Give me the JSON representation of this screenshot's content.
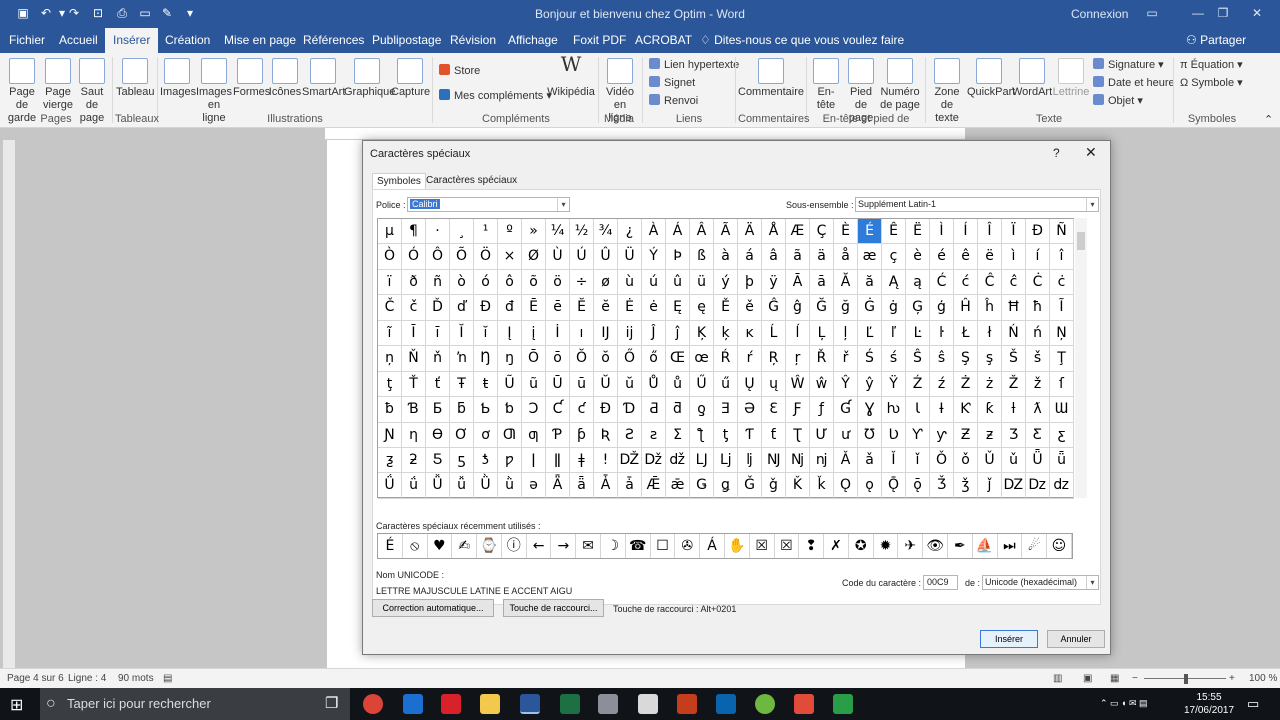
{
  "app": {
    "title": "Bonjour et bienvenu chez Optim - Word",
    "signin": "Connexion",
    "share": "Partager",
    "tell_me": "Dites-nous ce que vous voulez faire"
  },
  "tabs": [
    "Fichier",
    "Accueil",
    "Insérer",
    "Création",
    "Mise en page",
    "Références",
    "Publipostage",
    "Révision",
    "Affichage",
    "Foxit PDF",
    "ACROBAT"
  ],
  "ribbon": {
    "pages": [
      "Page de garde",
      "Page vierge",
      "Saut de page"
    ],
    "tableau": "Tableau",
    "illustrations": [
      "Images",
      "Images en ligne",
      "Formes",
      "Icônes",
      "SmartArt",
      "Graphique",
      "Capture"
    ],
    "store": "Store",
    "mes_complements": "Mes compléments",
    "wikipedia": "Wikipédia",
    "video": "Vidéo en ligne",
    "liens": [
      "Lien hypertexte",
      "Signet",
      "Renvoi"
    ],
    "commentaire": "Commentaire",
    "entete": [
      "En-tête",
      "Pied de page",
      "Numéro de page"
    ],
    "texte": [
      "Zone de texte",
      "QuickPart",
      "WordArt",
      "Lettrine"
    ],
    "texte_small": [
      "Signature",
      "Date et heure",
      "Objet"
    ],
    "symboles": [
      "Équation",
      "Symbole"
    ],
    "groups": [
      "Pages",
      "Tableaux",
      "Illustrations",
      "Compléments",
      "Média",
      "Liens",
      "Commentaires",
      "En-tête et pied de page",
      "Texte",
      "Symboles"
    ]
  },
  "dialog": {
    "title": "Caractères spéciaux",
    "help": "?",
    "tabs": [
      "Symboles",
      "Caractères spéciaux"
    ],
    "police_label": "Police :",
    "police_value": "Calibri",
    "subset_label": "Sous-ensemble :",
    "subset_value": "Supplément Latin-1",
    "symbols": [
      [
        "µ",
        "¶",
        "·",
        "¸",
        "¹",
        "º",
        "»",
        "¼",
        "½",
        "¾",
        "¿",
        "À",
        "Á",
        "Â",
        "Ã",
        "Ä",
        "Å",
        "Æ",
        "Ç",
        "È",
        "É",
        "Ê",
        "Ë",
        "Ì",
        "Í",
        "Î",
        "Ï",
        "Ð",
        "Ñ"
      ],
      [
        "Ò",
        "Ó",
        "Ô",
        "Õ",
        "Ö",
        "×",
        "Ø",
        "Ù",
        "Ú",
        "Û",
        "Ü",
        "Ý",
        "Þ",
        "ß",
        "à",
        "á",
        "â",
        "ã",
        "ä",
        "å",
        "æ",
        "ç",
        "è",
        "é",
        "ê",
        "ë",
        "ì",
        "í",
        "î"
      ],
      [
        "ï",
        "ð",
        "ñ",
        "ò",
        "ó",
        "ô",
        "õ",
        "ö",
        "÷",
        "ø",
        "ù",
        "ú",
        "û",
        "ü",
        "ý",
        "þ",
        "ÿ",
        "Ā",
        "ā",
        "Ă",
        "ă",
        "Ą",
        "ą",
        "Ć",
        "ć",
        "Ĉ",
        "ĉ",
        "Ċ",
        "ċ"
      ],
      [
        "Č",
        "č",
        "Ď",
        "ď",
        "Đ",
        "đ",
        "Ē",
        "ē",
        "Ĕ",
        "ĕ",
        "Ė",
        "ė",
        "Ę",
        "ę",
        "Ě",
        "ě",
        "Ĝ",
        "ĝ",
        "Ğ",
        "ğ",
        "Ġ",
        "ġ",
        "Ģ",
        "ģ",
        "Ĥ",
        "ĥ",
        "Ħ",
        "ħ",
        "Ĩ"
      ],
      [
        "ĩ",
        "Ī",
        "ī",
        "Ĭ",
        "ĭ",
        "Į",
        "į",
        "İ",
        "ı",
        "Ĳ",
        "ĳ",
        "Ĵ",
        "ĵ",
        "Ķ",
        "ķ",
        "ĸ",
        "Ĺ",
        "ĺ",
        "Ļ",
        "ļ",
        "Ľ",
        "ľ",
        "Ŀ",
        "ŀ",
        "Ł",
        "ł",
        "Ń",
        "ń",
        "Ņ"
      ],
      [
        "ņ",
        "Ň",
        "ň",
        "ŉ",
        "Ŋ",
        "ŋ",
        "Ō",
        "ō",
        "Ŏ",
        "ŏ",
        "Ő",
        "ő",
        "Œ",
        "œ",
        "Ŕ",
        "ŕ",
        "Ŗ",
        "ŗ",
        "Ř",
        "ř",
        "Ś",
        "ś",
        "Ŝ",
        "ŝ",
        "Ş",
        "ş",
        "Š",
        "š",
        "Ţ"
      ],
      [
        "ţ",
        "Ť",
        "ť",
        "Ŧ",
        "ŧ",
        "Ũ",
        "ũ",
        "Ū",
        "ū",
        "Ŭ",
        "ŭ",
        "Ů",
        "ů",
        "Ű",
        "ű",
        "Ų",
        "ų",
        "Ŵ",
        "ŵ",
        "Ŷ",
        "ŷ",
        "Ÿ",
        "Ź",
        "ź",
        "Ż",
        "ż",
        "Ž",
        "ž",
        "ſ"
      ],
      [
        "ƀ",
        "Ɓ",
        "Ƃ",
        "ƃ",
        "Ƅ",
        "ƅ",
        "Ɔ",
        "Ƈ",
        "ƈ",
        "Ɖ",
        "Ɗ",
        "Ƌ",
        "ƌ",
        "ƍ",
        "Ǝ",
        "Ə",
        "Ɛ",
        "Ƒ",
        "ƒ",
        "Ɠ",
        "Ɣ",
        "ƕ",
        "Ɩ",
        "Ɨ",
        "Ƙ",
        "ƙ",
        "ƚ",
        "ƛ",
        "Ɯ"
      ],
      [
        "Ɲ",
        "ƞ",
        "Ɵ",
        "Ơ",
        "ơ",
        "Ƣ",
        "ƣ",
        "Ƥ",
        "ƥ",
        "Ʀ",
        "Ƨ",
        "ƨ",
        "Ʃ",
        "ƪ",
        "ƫ",
        "Ƭ",
        "ƭ",
        "Ʈ",
        "Ư",
        "ư",
        "Ʊ",
        "Ʋ",
        "Ƴ",
        "ƴ",
        "Ƶ",
        "ƶ",
        "Ʒ",
        "Ƹ",
        "ƹ"
      ],
      [
        "ƺ",
        "ƻ",
        "Ƽ",
        "ƽ",
        "ƾ",
        "ƿ",
        "ǀ",
        "ǁ",
        "ǂ",
        "ǃ",
        "Ǆ",
        "ǅ",
        "ǆ",
        "Ǉ",
        "ǈ",
        "ǉ",
        "Ǌ",
        "ǋ",
        "ǌ",
        "Ǎ",
        "ǎ",
        "Ǐ",
        "ǐ",
        "Ǒ",
        "ǒ",
        "Ǔ",
        "ǔ",
        "Ǖ",
        "ǖ"
      ],
      [
        "Ǘ",
        "ǘ",
        "Ǚ",
        "ǚ",
        "Ǜ",
        "ǜ",
        "ǝ",
        "Ǟ",
        "ǟ",
        "Ǡ",
        "ǡ",
        "Ǣ",
        "ǣ",
        "Ǥ",
        "ǥ",
        "Ǧ",
        "ǧ",
        "Ǩ",
        "ǩ",
        "Ǫ",
        "ǫ",
        "Ǭ",
        "ǭ",
        "Ǯ",
        "ǯ",
        "ǰ",
        "Ǳ",
        "ǲ",
        "ǳ"
      ]
    ],
    "recent_label": "Caractères spéciaux récemment utilisés :",
    "recent": [
      "É",
      "⦸",
      "♥",
      "✍",
      "⌚",
      "ⓘ",
      "←",
      "→",
      "✉",
      "☽",
      "☎",
      "☐",
      "✇",
      "Á",
      "✋",
      "☒",
      "☒",
      "❢",
      "✗",
      "✪",
      "✹",
      "✈",
      "👁",
      "✒",
      "⛵",
      "⏭",
      "☄",
      "☺"
    ],
    "unicode_name_label": "Nom UNICODE :",
    "unicode_name": "LETTRE MAJUSCULE LATINE E ACCENT AIGU",
    "code_label": "Code du caractère :",
    "code_value": "00C9",
    "de_label": "de :",
    "de_value": "Unicode (hexadécimal)",
    "autocorrect": "Correction automatique...",
    "shortcut_button": "Touche de raccourci...",
    "shortcut_text": "Touche de raccourci : Alt+0201",
    "insert": "Insérer",
    "cancel": "Annuler"
  },
  "status": {
    "page": "Page 4 sur 6",
    "line": "Ligne : 4",
    "words": "90 mots",
    "zoom": "100 %"
  },
  "taskbar": {
    "search": "Taper ici pour rechercher",
    "time": "15:55",
    "date": "17/06/2017"
  }
}
